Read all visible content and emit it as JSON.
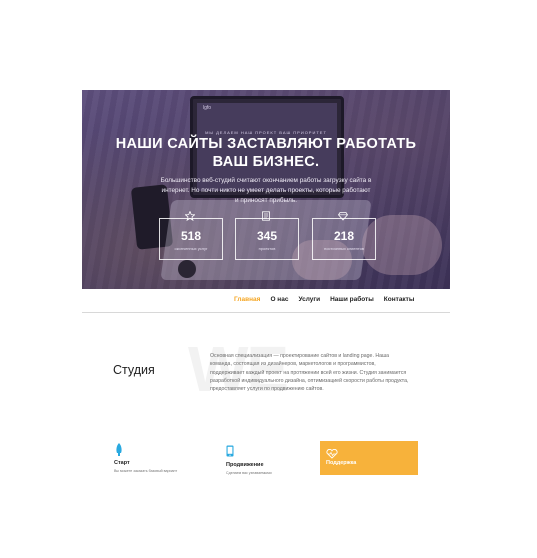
{
  "hero": {
    "laptop_logo": "lgfo",
    "tagline": "МЫ ДЕЛАЕМ НАШ ПРОЕКТ ВАШ ПРИОРИТЕТ",
    "headline_line1": "НАШИ САЙТЫ ЗАСТАВЛЯЮТ РАБОТАТЬ",
    "headline_line2": "ВАШ БИЗНЕС.",
    "lead": "Большинство веб-студий считают окончанием работы загрузку сайта в интернет. Но почти никто не умеет делать проекты, которые работают и приносят прибыль.",
    "stats": [
      {
        "icon": "star-icon",
        "value": "518",
        "label": "оконченных услуг"
      },
      {
        "icon": "document-icon",
        "value": "345",
        "label": "проектов"
      },
      {
        "icon": "diamond-icon",
        "value": "218",
        "label": "постоянных клиентов"
      }
    ]
  },
  "nav": {
    "items": [
      "Главная",
      "О нас",
      "Услуги",
      "Наши работы",
      "Контакты"
    ],
    "active_index": 0,
    "active_color": "#f5a623"
  },
  "studio": {
    "watermark": "WE",
    "title": "Студия",
    "text": "Основная специализация — проектирование сайтов и landing page. Наша команда, состоящая из дизайнеров, маркетологов и программистов, поддерживает каждый проект на протяжении всей его жизни. Студия занимается разработкой индивидуального дизайна, оптимизацией скорости работы продукта, предоставляет услуги по продвижению сайтов."
  },
  "cards": [
    {
      "icon": "rocket-icon",
      "title": "Старт",
      "subtitle": "Вы можете заказать базовый вариант"
    },
    {
      "icon": "mobile-icon",
      "title": "Продвижение",
      "subtitle": "Сделаем вас узнаваемыми"
    },
    {
      "icon": "heartbeat-icon",
      "title": "Поддержка",
      "subtitle": "",
      "highlight_color": "#f7b23b"
    }
  ],
  "colors": {
    "accent": "#f5a623",
    "hero_overlay": "#4b3f6a",
    "card_icon": "#29a9e0"
  }
}
